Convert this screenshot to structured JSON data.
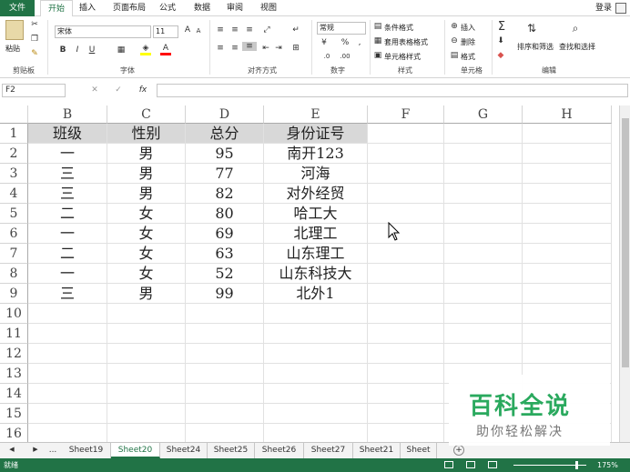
{
  "tabs": {
    "file": "文件",
    "home": "开始",
    "insert": "插入",
    "layout": "页面布局",
    "formulas": "公式",
    "data": "数据",
    "review": "审阅",
    "view": "视图",
    "login": "登录"
  },
  "ribbon": {
    "paste": "粘贴",
    "clipboard": "剪贴板",
    "font_group": "字体",
    "font_name": "宋体",
    "font_size": "11",
    "align_group": "对齐方式",
    "number_group": "数字",
    "number_format": "常规",
    "percent": "%",
    "comma": ",",
    "styles_group": "样式",
    "cond_format": "条件格式",
    "table_format": "套用表格格式",
    "cell_styles": "单元格样式",
    "cells_group": "单元格",
    "insert": "插入",
    "delete": "删除",
    "format": "格式",
    "edit_group": "编辑",
    "sort_filter": "排序和筛选",
    "find_select": "查找和选择",
    "bold": "B",
    "italic": "I",
    "underline": "U",
    "fx": "fx"
  },
  "namebox": "F2",
  "columns": [
    "B",
    "C",
    "D",
    "E",
    "F",
    "G",
    "H"
  ],
  "rows": [
    "1",
    "2",
    "3",
    "4",
    "5",
    "6",
    "7",
    "8",
    "9",
    "10",
    "11",
    "12",
    "13",
    "14",
    "15",
    "16"
  ],
  "table": {
    "headers": [
      "班级",
      "性别",
      "总分",
      "身份证号"
    ],
    "data": [
      [
        "一",
        "男",
        "95",
        "南开123"
      ],
      [
        "三",
        "男",
        "77",
        "河海"
      ],
      [
        "三",
        "男",
        "82",
        "对外经贸"
      ],
      [
        "二",
        "女",
        "80",
        "哈工大"
      ],
      [
        "一",
        "女",
        "69",
        "北理工"
      ],
      [
        "二",
        "女",
        "63",
        "山东理工"
      ],
      [
        "一",
        "女",
        "52",
        "山东科技大"
      ],
      [
        "三",
        "男",
        "99",
        "北外1"
      ]
    ]
  },
  "sheets": {
    "ellipsis": "...",
    "tabs": [
      "Sheet19",
      "Sheet20",
      "Sheet24",
      "Sheet25",
      "Sheet26",
      "Sheet27",
      "Sheet21",
      "Sheet"
    ],
    "active": "Sheet20"
  },
  "status": {
    "ready": "就绪",
    "zoom": "175%"
  },
  "watermark": {
    "title": "百科全说",
    "subtitle": "助你轻松解决"
  }
}
